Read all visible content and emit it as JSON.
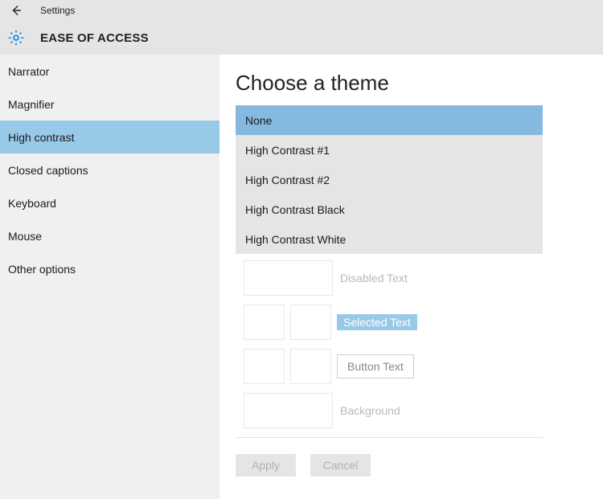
{
  "titlebar": {
    "title": "Settings"
  },
  "category": {
    "title": "EASE OF ACCESS"
  },
  "sidebar": {
    "items": [
      {
        "label": "Narrator"
      },
      {
        "label": "Magnifier"
      },
      {
        "label": "High contrast"
      },
      {
        "label": "Closed captions"
      },
      {
        "label": "Keyboard"
      },
      {
        "label": "Mouse"
      },
      {
        "label": "Other options"
      }
    ],
    "selectedIndex": 2
  },
  "page": {
    "title": "Choose a theme",
    "themes": [
      {
        "label": "None"
      },
      {
        "label": "High Contrast #1"
      },
      {
        "label": "High Contrast #2"
      },
      {
        "label": "High Contrast Black"
      },
      {
        "label": "High Contrast White"
      }
    ],
    "selectedThemeIndex": 0,
    "preview": {
      "disabled_text": "Disabled Text",
      "selected_text": "Selected Text",
      "button_text": "Button Text",
      "background": "Background"
    },
    "actions": {
      "apply": "Apply",
      "cancel": "Cancel"
    }
  }
}
